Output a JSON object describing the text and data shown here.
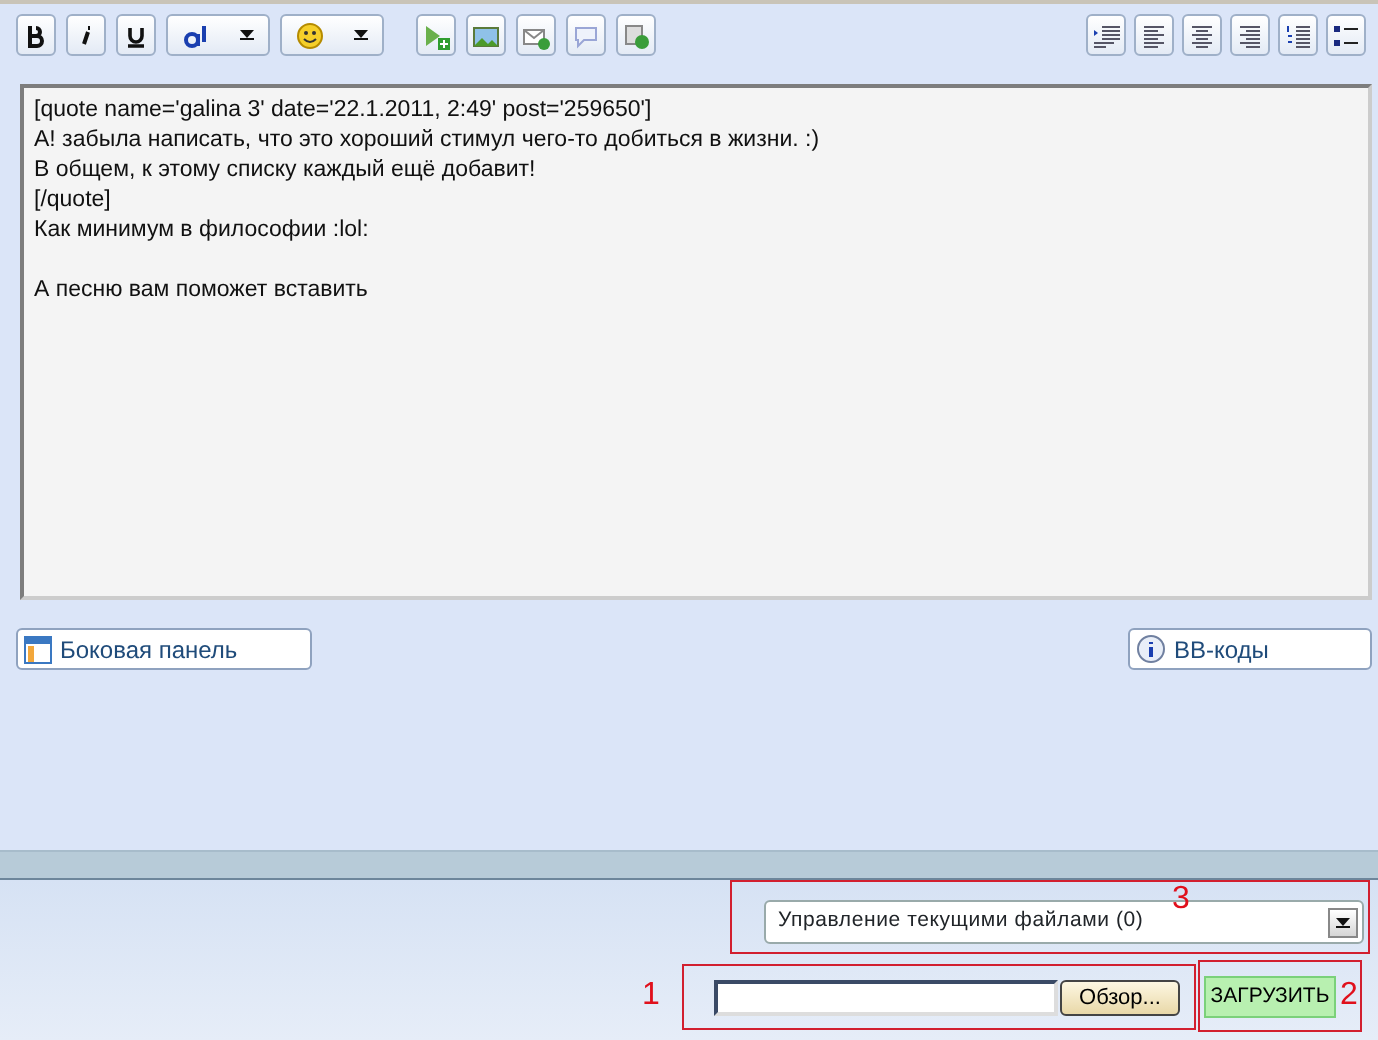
{
  "editor": {
    "paragraphs": [
      [
        "[quote name='galina 3' date='22.1.2011, 2:49' post='259650']",
        "А! забыла написать, что это хороший стимул чего-то добиться в жизни. :)",
        "В общем, к этому списку каждый ещё добавит!",
        "[/quote]",
        "Как минимум в философии :lol:"
      ],
      [
        "А песню вам поможет вставить"
      ]
    ]
  },
  "side_panel_button": "Боковая панель",
  "bbcodes_button": "BB-коды",
  "file_manager_select": {
    "value": "Управление текущими файлами (0)"
  },
  "browse_button": "Обзор...",
  "upload_button": "ЗАГРУЗИТЬ",
  "annotations": [
    {
      "label": "3"
    },
    {
      "label": "1"
    },
    {
      "label": "2"
    }
  ]
}
